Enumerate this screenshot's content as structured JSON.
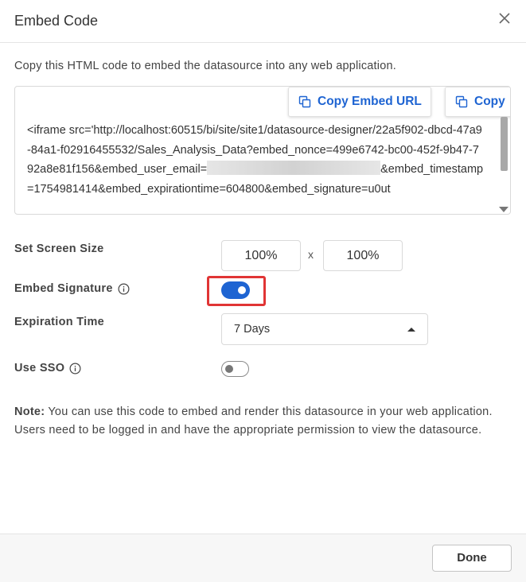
{
  "dialog": {
    "title": "Embed Code",
    "close_icon": "close-icon"
  },
  "intro_text": "Copy this HTML code to embed the datasource into any web application.",
  "code_box": {
    "copy_url_label": "Copy Embed URL",
    "copy_code_label": "Copy",
    "copy_icon": "copy-icon",
    "code_before_email": "<iframe src='http://localhost:60515/bi/site/site1/datasource-designer/22a5f902-dbcd-47a9-84a1-f02916455532/Sales_Analysis_Data?embed_nonce=499e6742-bc00-452f-9b47-792a8e81f156&embed_user_email=",
    "code_after_email": "&embed_timestamp=1754981414&embed_expirationtime=604800&embed_signature=u0ut"
  },
  "screen_size": {
    "label": "Set Screen Size",
    "width": "100%",
    "separator": "x",
    "height": "100%"
  },
  "embed_signature": {
    "label": "Embed Signature",
    "info_icon": "info-icon",
    "enabled": true
  },
  "expiration": {
    "label": "Expiration Time",
    "selected": "7 Days"
  },
  "use_sso": {
    "label": "Use SSO",
    "info_icon": "info-icon",
    "enabled": false
  },
  "note": {
    "prefix": "Note:",
    "text": " You can use this code to embed and render this datasource in your web application. Users need to be logged in and have the appropriate permission to view the datasource."
  },
  "footer": {
    "done_label": "Done"
  },
  "colors": {
    "accent": "#1e64d2",
    "highlight": "#e03535"
  }
}
